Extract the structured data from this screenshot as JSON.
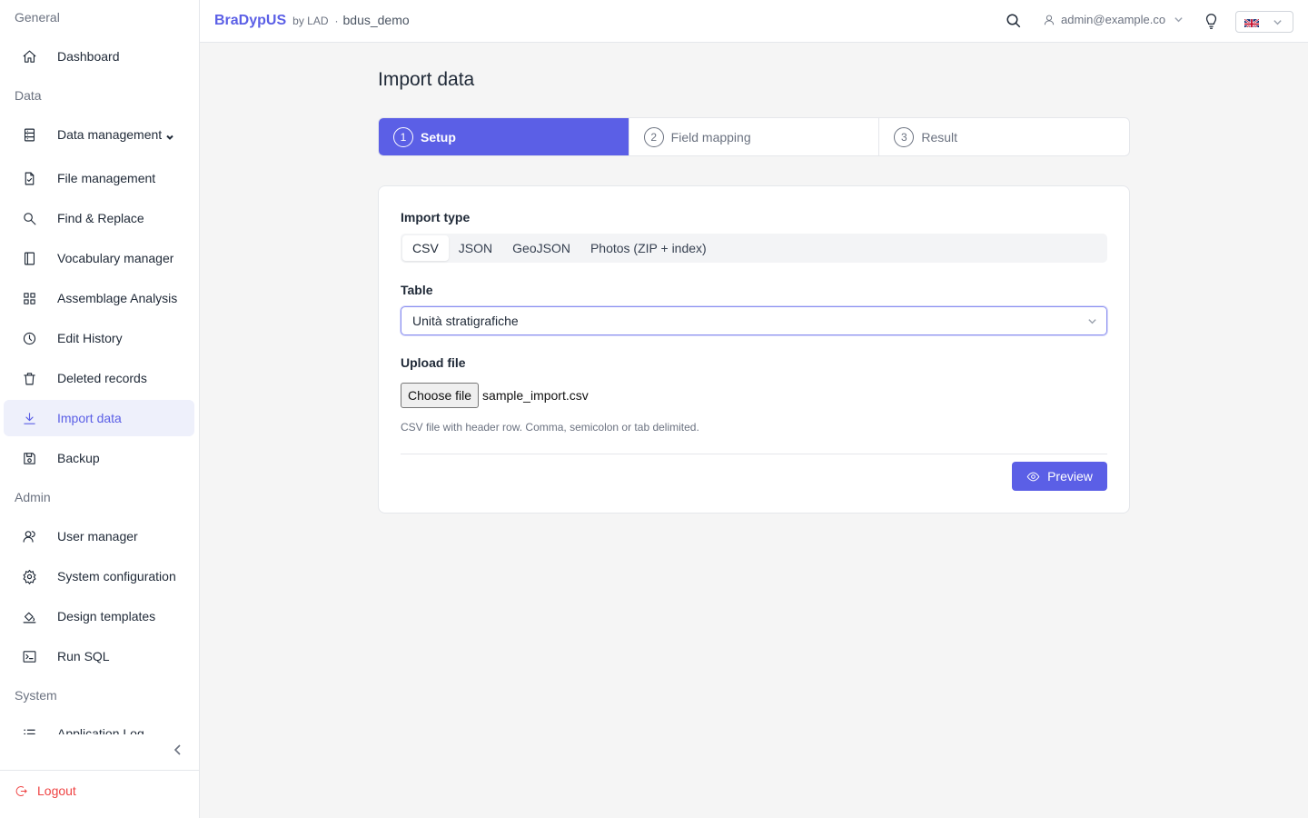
{
  "topbar": {
    "brand": "BraDypUS",
    "brand_by": "by LAD",
    "separator": "·",
    "database": "bdus_demo",
    "user_email": "admin@example.com",
    "language_flag": "gb-flag-icon"
  },
  "sidebar": {
    "sections": {
      "general": "General",
      "data": "Data",
      "admin": "Admin",
      "system": "System"
    },
    "items": {
      "dashboard": "Dashboard",
      "data_management": "Data management",
      "file_management": "File management",
      "find_replace": "Find & Replace",
      "vocabulary_manager": "Vocabulary manager",
      "assemblage_analysis": "Assemblage Analysis",
      "edit_history": "Edit History",
      "deleted_records": "Deleted records",
      "import_data": "Import data",
      "backup": "Backup",
      "user_manager": "User manager",
      "system_configuration": "System configuration",
      "design_templates": "Design templates",
      "run_sql": "Run SQL",
      "application_log": "Application Log"
    },
    "logout": "Logout"
  },
  "main": {
    "title": "Import data",
    "steps": [
      {
        "num": "1",
        "label": "Setup"
      },
      {
        "num": "2",
        "label": "Field mapping"
      },
      {
        "num": "3",
        "label": "Result"
      }
    ],
    "import_type_label": "Import type",
    "import_types": [
      "CSV",
      "JSON",
      "GeoJSON",
      "Photos (ZIP + index)"
    ],
    "selected_import_type": "CSV",
    "table_label": "Table",
    "table_value": "Unità stratigrafiche",
    "upload_label": "Upload file",
    "choose_file_label": "Choose file",
    "file_name": "sample_import.csv",
    "help_text": "CSV file with header row. Comma, semicolon or tab delimited.",
    "preview_label": "Preview"
  },
  "colors": {
    "accent": "#5b5fe6",
    "danger": "#ef4444"
  }
}
